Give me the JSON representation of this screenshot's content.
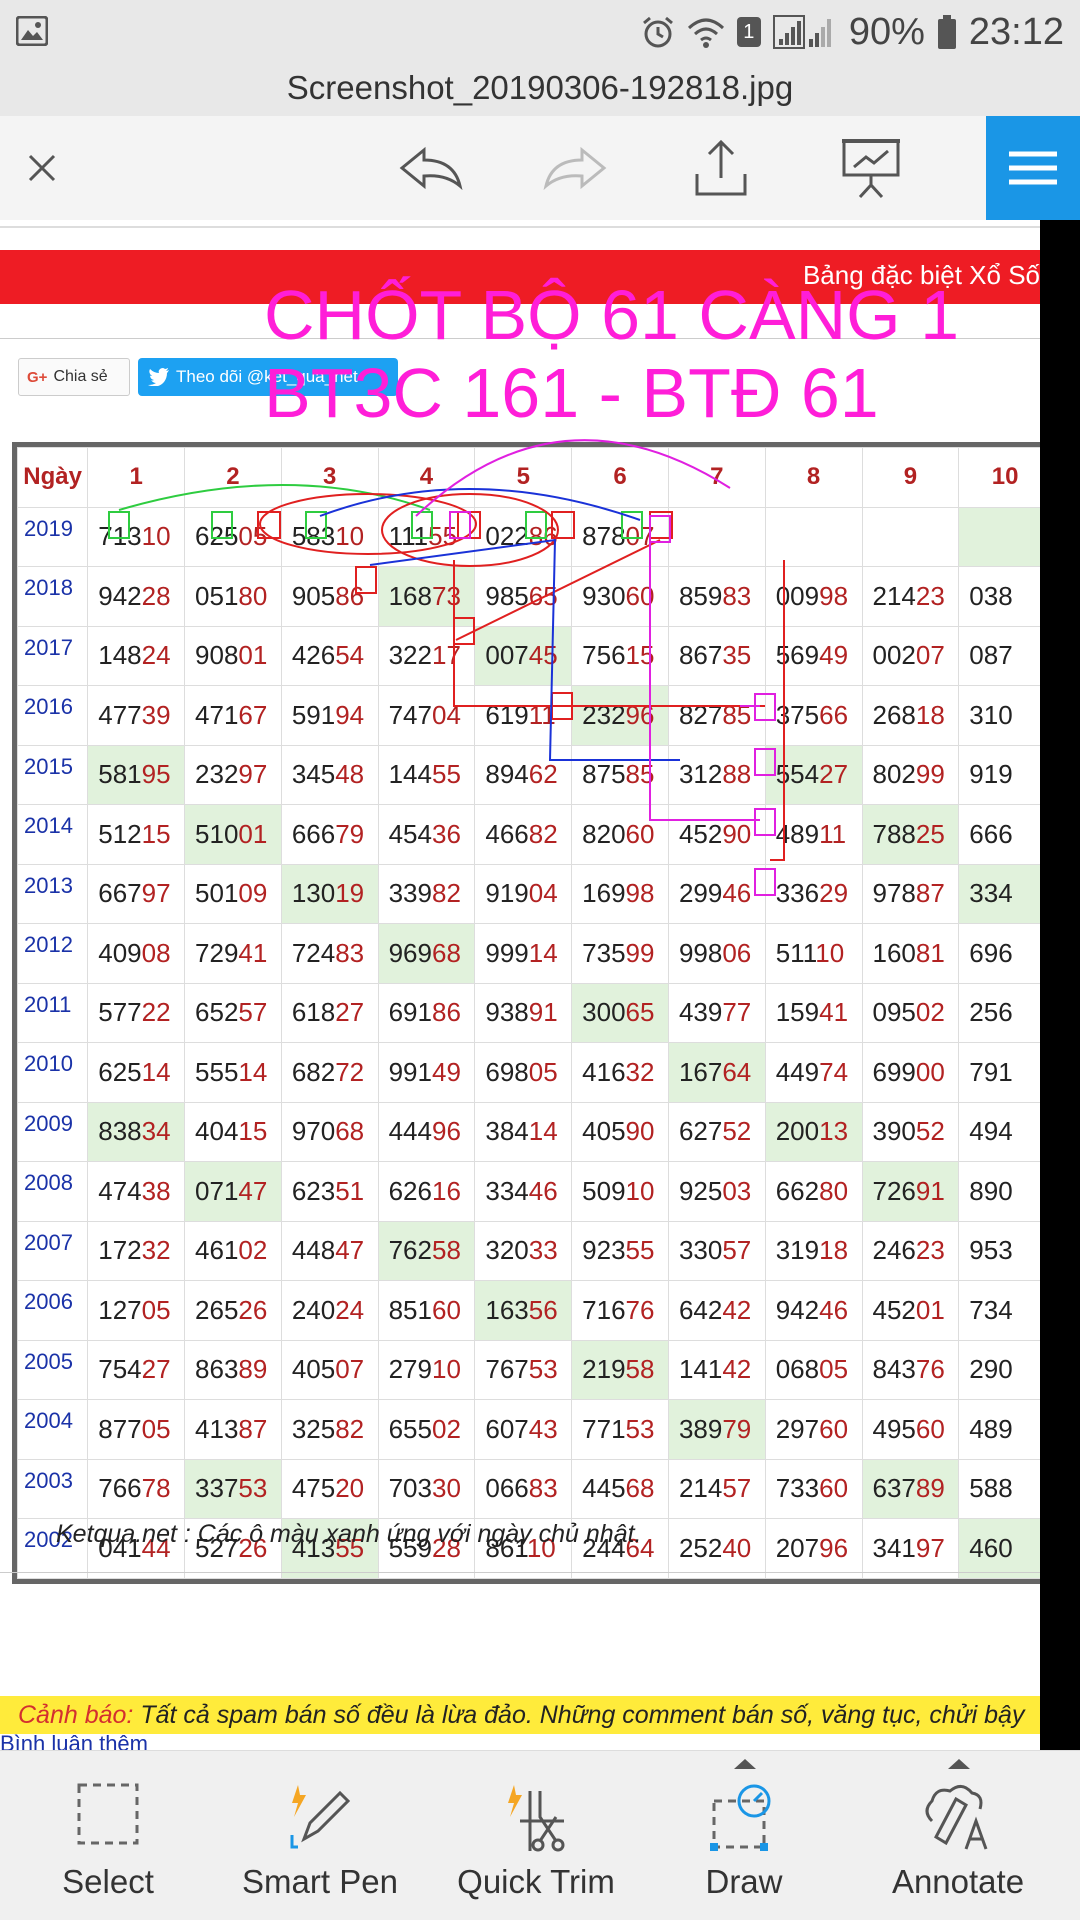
{
  "status": {
    "battery": "90%",
    "time": "23:12",
    "notif_count": "1"
  },
  "file_title": "Screenshot_20190306-192818.jpg",
  "page": {
    "banner": "Bảng đặc biệt Xổ Số",
    "share_label": "Chia sẻ",
    "follow_label": "Theo dõi @ket_qua_net",
    "overlay_line1": "CHỐT BỘ 61 CÀNG 1",
    "overlay_line2": "BT3C 161 - BTĐ 61",
    "note": "Ketqua.net : Các ô màu xanh ứng với ngày chủ nhật.",
    "warning_label": "Cảnh báo:",
    "warning_text": " Tất cả spam bán số đều là lừa đảo. Những comment bán số, văng tục, chửi bậy",
    "more_comments": "Bình luận thêm"
  },
  "table": {
    "headers": [
      "Ngày",
      "1",
      "2",
      "3",
      "4",
      "5",
      "6",
      "7",
      "8",
      "9",
      "10"
    ],
    "rows": [
      {
        "year": "2019",
        "cells": [
          "71310",
          "62505",
          "58310",
          "11155",
          "02286",
          "87807",
          "",
          "",
          "",
          ""
        ],
        "green": [
          9
        ]
      },
      {
        "year": "2018",
        "cells": [
          "94228",
          "05180",
          "90586",
          "16873",
          "98565",
          "93060",
          "85983",
          "00998",
          "21423",
          "038"
        ],
        "green": [
          3
        ]
      },
      {
        "year": "2017",
        "cells": [
          "14824",
          "90801",
          "42654",
          "32217",
          "00745",
          "75615",
          "86735",
          "56949",
          "00207",
          "087"
        ],
        "green": [
          4
        ]
      },
      {
        "year": "2016",
        "cells": [
          "47739",
          "47167",
          "59194",
          "74704",
          "61911",
          "23296",
          "82785",
          "37566",
          "26818",
          "310"
        ],
        "green": [
          5
        ]
      },
      {
        "year": "2015",
        "cells": [
          "58195",
          "23297",
          "34548",
          "14455",
          "89462",
          "87585",
          "31288",
          "55427",
          "80299",
          "919"
        ],
        "green": [
          0,
          7
        ]
      },
      {
        "year": "2014",
        "cells": [
          "51215",
          "51001",
          "66679",
          "45436",
          "46682",
          "82060",
          "45290",
          "48911",
          "78825",
          "666"
        ],
        "green": [
          1,
          8
        ]
      },
      {
        "year": "2013",
        "cells": [
          "66797",
          "50109",
          "13019",
          "33982",
          "91904",
          "16998",
          "29946",
          "33629",
          "97887",
          "334"
        ],
        "green": [
          2,
          9
        ]
      },
      {
        "year": "2012",
        "cells": [
          "40908",
          "72941",
          "72483",
          "96968",
          "99914",
          "73599",
          "99806",
          "51110",
          "16081",
          "696"
        ],
        "green": [
          3
        ]
      },
      {
        "year": "2011",
        "cells": [
          "57722",
          "65257",
          "61827",
          "69186",
          "93891",
          "30065",
          "43977",
          "15941",
          "09502",
          "256"
        ],
        "green": [
          5
        ]
      },
      {
        "year": "2010",
        "cells": [
          "62514",
          "55514",
          "68272",
          "99149",
          "69805",
          "41632",
          "16764",
          "44974",
          "69900",
          "791"
        ],
        "green": [
          6
        ]
      },
      {
        "year": "2009",
        "cells": [
          "83834",
          "40415",
          "97068",
          "44496",
          "38414",
          "40590",
          "62752",
          "20013",
          "39052",
          "494"
        ],
        "green": [
          0,
          7
        ]
      },
      {
        "year": "2008",
        "cells": [
          "47438",
          "07147",
          "62351",
          "62616",
          "33446",
          "50910",
          "92503",
          "66280",
          "72691",
          "890"
        ],
        "green": [
          1,
          8
        ]
      },
      {
        "year": "2007",
        "cells": [
          "17232",
          "46102",
          "44847",
          "76258",
          "32033",
          "92355",
          "33057",
          "31918",
          "24623",
          "953"
        ],
        "green": [
          3
        ]
      },
      {
        "year": "2006",
        "cells": [
          "12705",
          "26526",
          "24024",
          "85160",
          "16356",
          "71676",
          "64242",
          "94246",
          "45201",
          "734"
        ],
        "green": [
          4
        ]
      },
      {
        "year": "2005",
        "cells": [
          "75427",
          "86389",
          "40507",
          "27910",
          "76753",
          "21958",
          "14142",
          "06805",
          "84376",
          "290"
        ],
        "green": [
          5
        ]
      },
      {
        "year": "2004",
        "cells": [
          "87705",
          "41387",
          "32582",
          "65502",
          "60743",
          "77153",
          "38979",
          "29760",
          "49560",
          "489"
        ],
        "green": [
          6
        ]
      },
      {
        "year": "2003",
        "cells": [
          "76678",
          "33753",
          "47520",
          "70330",
          "06683",
          "44568",
          "21457",
          "73360",
          "63789",
          "588"
        ],
        "green": [
          1,
          8
        ]
      },
      {
        "year": "2002",
        "cells": [
          "04144",
          "52726",
          "41355",
          "55928",
          "86110",
          "24464",
          "25240",
          "20796",
          "34197",
          "460"
        ],
        "green": [
          2,
          9
        ]
      }
    ]
  },
  "bottom_tools": [
    {
      "label": "Select",
      "icon": "select-icon"
    },
    {
      "label": "Smart Pen",
      "icon": "smart-pen-icon"
    },
    {
      "label": "Quick Trim",
      "icon": "quick-trim-icon"
    },
    {
      "label": "Draw",
      "icon": "draw-icon"
    },
    {
      "label": "Annotate",
      "icon": "annotate-icon"
    }
  ],
  "colors": {
    "accent_blue": "#1a96e6",
    "banner_red": "#ee1c24",
    "overlay_magenta": "#ff1ed8",
    "green_cell": "#e1f2dc",
    "warning_yellow": "#ffeb3b"
  }
}
